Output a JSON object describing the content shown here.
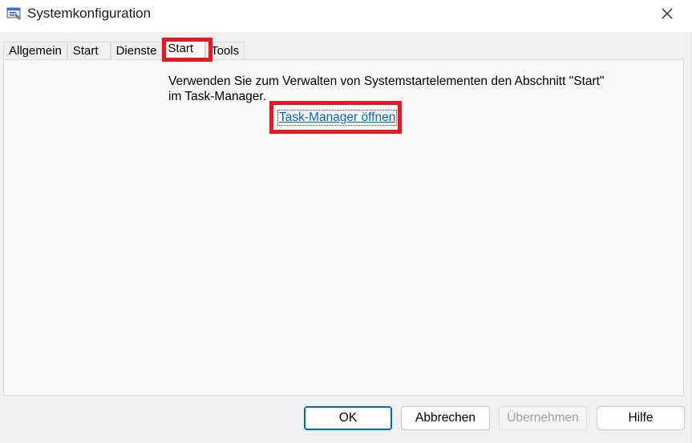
{
  "window": {
    "title": "Systemkonfiguration",
    "icon": "msconfig-app-icon",
    "close_icon": "close-icon"
  },
  "tabs": [
    {
      "label": "Allgemein",
      "active": false
    },
    {
      "label": "Start",
      "active": false
    },
    {
      "label": "Dienste",
      "active": false
    },
    {
      "label": "Start",
      "active": true
    },
    {
      "label": "Tools",
      "active": false
    }
  ],
  "panel": {
    "message_line1": "Verwenden Sie zum Verwalten von Systemstartelementen den Abschnitt \"Start\"",
    "message_line2": "im Task-Manager.",
    "link_label": "Task-Manager öffnen"
  },
  "buttons": {
    "ok": "OK",
    "cancel": "Abbrechen",
    "apply": "Übernehmen",
    "help": "Hilfe"
  },
  "colors": {
    "highlight": "#e01b24",
    "link": "#0066cc",
    "primary_border": "#0067c0"
  }
}
